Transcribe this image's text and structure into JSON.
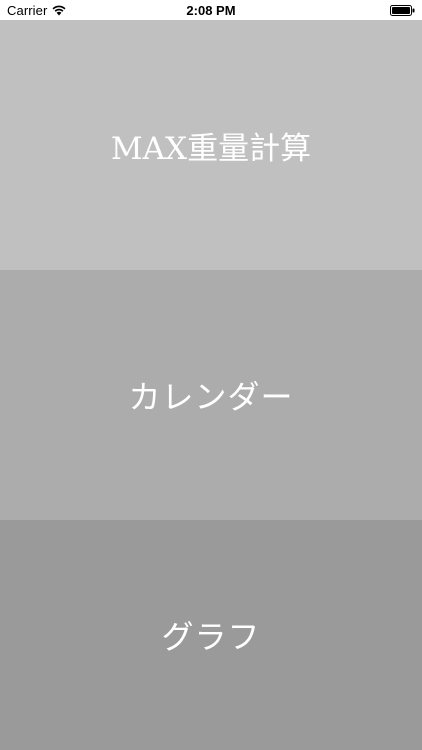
{
  "status_bar": {
    "carrier": "Carrier",
    "time": "2:08 PM",
    "wifi_icon": "wifi-icon",
    "battery_icon": "battery-icon"
  },
  "menu": {
    "max_weight_label": "MAX重量計算",
    "calendar_label": "カレンダー",
    "graph_label": "グラフ"
  },
  "colors": {
    "panel_max_bg": "#c0c0c0",
    "panel_calendar_bg": "#acacac",
    "panel_graph_bg": "#9a9a9a",
    "label_text": "#ffffff"
  }
}
